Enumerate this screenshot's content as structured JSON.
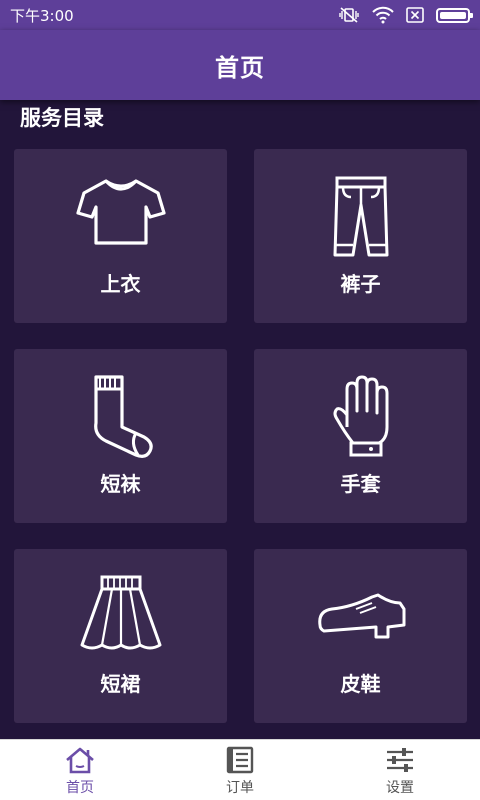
{
  "status_bar": {
    "time": "下午3:00",
    "icons": [
      "vibrate-off-icon",
      "wifi-icon",
      "no-sim-icon",
      "battery-icon"
    ]
  },
  "app_bar": {
    "title": "首页"
  },
  "section": {
    "title": "服务目录"
  },
  "services": [
    {
      "label": "上衣",
      "icon": "tshirt-icon"
    },
    {
      "label": "裤子",
      "icon": "pants-icon"
    },
    {
      "label": "短袜",
      "icon": "sock-icon"
    },
    {
      "label": "手套",
      "icon": "glove-icon"
    },
    {
      "label": "短裙",
      "icon": "skirt-icon"
    },
    {
      "label": "皮鞋",
      "icon": "shoe-icon"
    }
  ],
  "bottom_nav": [
    {
      "label": "首页",
      "icon": "home-icon",
      "active": true
    },
    {
      "label": "订单",
      "icon": "orders-icon",
      "active": false
    },
    {
      "label": "设置",
      "icon": "settings-sliders-icon",
      "active": false
    }
  ],
  "colors": {
    "primary": "#5e3f99",
    "background": "#22153a",
    "card": "#3a2a50",
    "nav_active": "#6b4ea8",
    "nav_inactive": "#555555"
  }
}
